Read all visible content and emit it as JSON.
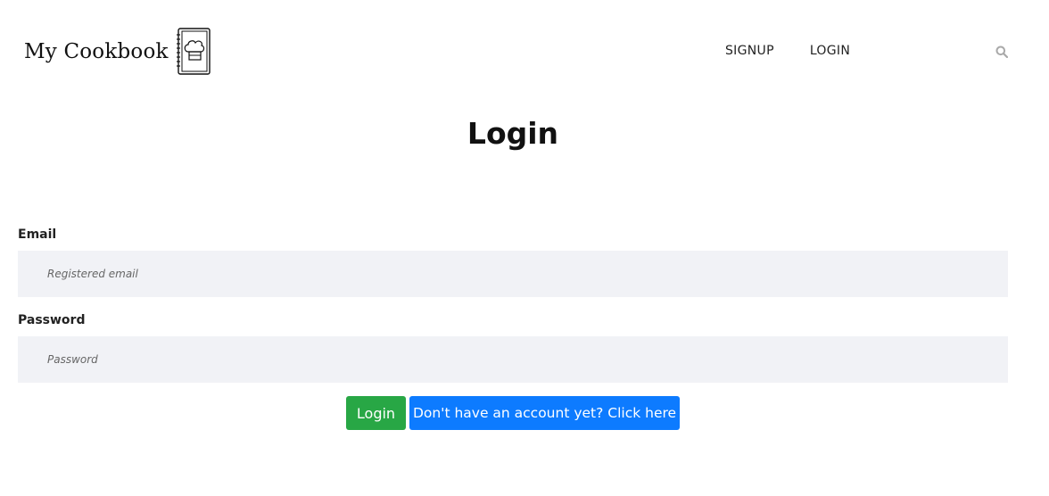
{
  "brand": {
    "name": "My Cookbook",
    "icon": "cookbook-chef-hat-icon"
  },
  "nav": {
    "signup": "SIGNUP",
    "login": "LOGIN",
    "search_icon": "search-icon"
  },
  "page": {
    "title": "Login"
  },
  "form": {
    "email": {
      "label": "Email",
      "placeholder": "Registered email",
      "value": ""
    },
    "password": {
      "label": "Password",
      "placeholder": "Password",
      "value": ""
    }
  },
  "buttons": {
    "login": "Login",
    "signup_link": "Don't have an account yet? Click here"
  },
  "colors": {
    "login_button": "#28a745",
    "signup_button": "#0d7bff",
    "input_background": "#f1f2f6"
  }
}
